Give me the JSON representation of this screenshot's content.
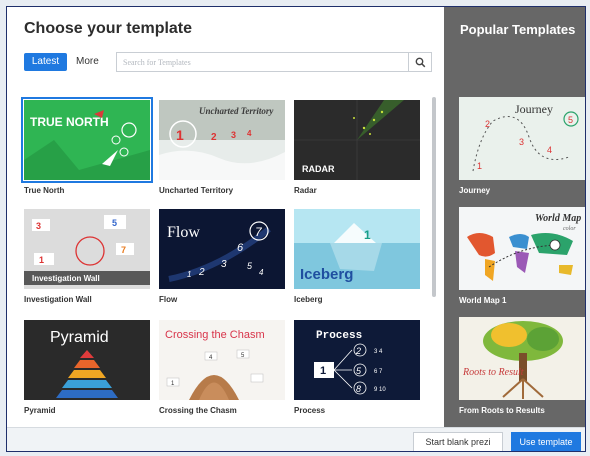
{
  "dialog": {
    "title": "Choose your template",
    "tabs": {
      "latest": "Latest",
      "more": "More"
    },
    "search": {
      "placeholder": "Search for Templates"
    }
  },
  "templates": [
    {
      "label": "True North",
      "thumb_text": "TRUE NORTH",
      "selected": true
    },
    {
      "label": "Uncharted Territory",
      "thumb_text": "Uncharted Territory"
    },
    {
      "label": "Radar",
      "thumb_text": "RADAR"
    },
    {
      "label": "Investigation Wall",
      "thumb_text": "Investigation Wall"
    },
    {
      "label": "Flow",
      "thumb_text": "Flow"
    },
    {
      "label": "Iceberg",
      "thumb_text": "Iceberg"
    },
    {
      "label": "Pyramid",
      "thumb_text": "Pyramid"
    },
    {
      "label": "Crossing the Chasm",
      "thumb_text": "Crossing the Chasm"
    },
    {
      "label": "Process",
      "thumb_text": "Process"
    }
  ],
  "popular": {
    "title": "Popular Templates",
    "items": [
      {
        "label": "Journey",
        "thumb_text": "Journey"
      },
      {
        "label": "World Map 1",
        "thumb_text": "World Map",
        "thumb_subtext": "color"
      },
      {
        "label": "From Roots to Results",
        "thumb_text": "Roots to Result"
      }
    ]
  },
  "footer": {
    "blank_label": "Start blank prezi",
    "use_label": "Use template"
  },
  "colors": {
    "accent": "#1f79e0",
    "sidebar": "#676767"
  }
}
